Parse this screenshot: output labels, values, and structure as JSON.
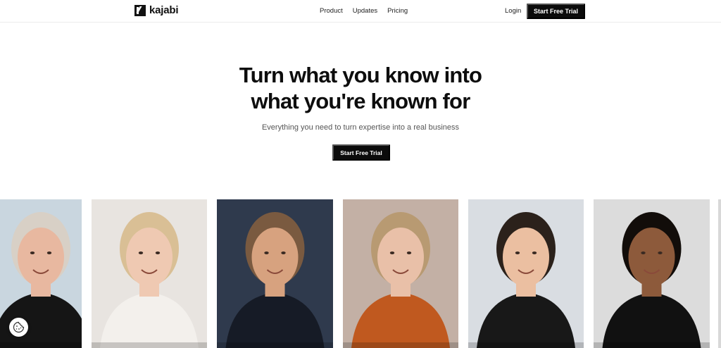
{
  "header": {
    "brand": "kajabi",
    "nav": [
      "Product",
      "Updates",
      "Pricing"
    ],
    "login": "Login",
    "cta": "Start Free Trial"
  },
  "hero": {
    "title_line1": "Turn what you know into",
    "title_line2": "what you're known for",
    "subtitle": "Everything you need to turn expertise into a real business",
    "cta": "Start Free Trial"
  },
  "cards": [
    {
      "name": "creator-portrait-1",
      "bg": "#c9d6df",
      "skin": "#e8b8a0",
      "hair": "#d8d0c6",
      "shirt": "#151515"
    },
    {
      "name": "creator-portrait-2",
      "bg": "#e8e4e0",
      "skin": "#efc9b2",
      "hair": "#d9bf95",
      "shirt": "#f3f0ec"
    },
    {
      "name": "creator-portrait-3",
      "bg": "#2f3a4d",
      "skin": "#d7a27f",
      "hair": "#7a5a40",
      "shirt": "#161b26"
    },
    {
      "name": "creator-portrait-4",
      "bg": "#c3b0a5",
      "skin": "#e9c0a8",
      "hair": "#b89a72",
      "shirt": "#c0591f"
    },
    {
      "name": "creator-portrait-5",
      "bg": "#d9dde2",
      "skin": "#ebbfa1",
      "hair": "#2b211b",
      "shirt": "#181818"
    },
    {
      "name": "creator-portrait-6",
      "bg": "#dcdcdc",
      "skin": "#8d5a3b",
      "hair": "#120d0a",
      "shirt": "#111111"
    }
  ],
  "icons": {
    "cookie": "cookie-icon"
  }
}
